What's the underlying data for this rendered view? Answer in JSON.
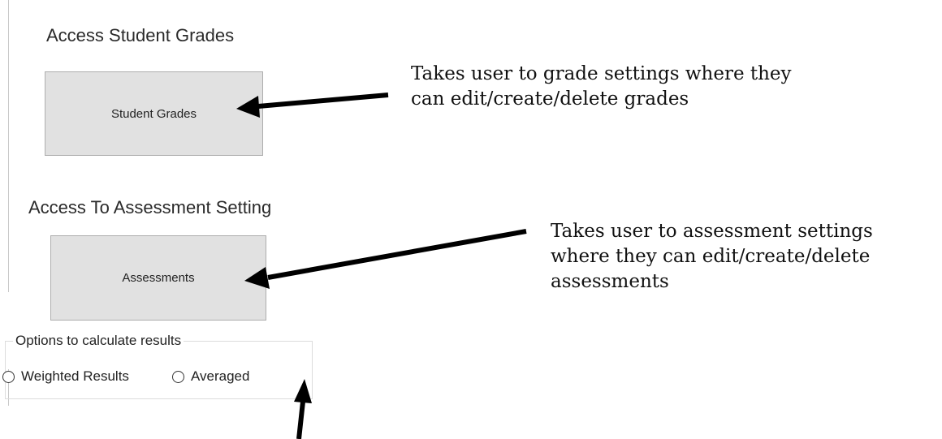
{
  "grades_section": {
    "label": "Access Student Grades",
    "button_label": "Student Grades",
    "annotation_line1": "Takes user to grade settings where they",
    "annotation_line2": "can edit/create/delete grades"
  },
  "assessment_section": {
    "label": "Access To Assessment Setting",
    "button_label": "Assessments",
    "annotation_line1": "Takes user to assessment settings",
    "annotation_line2": "where they can edit/create/delete",
    "annotation_line3": "assessments"
  },
  "results_options": {
    "legend": "Options to calculate results",
    "options": [
      {
        "label": "Weighted Results",
        "selected": false
      },
      {
        "label": "Averaged",
        "selected": false
      }
    ]
  },
  "colors": {
    "button_bg": "#e1e1e1",
    "button_border": "#adadad",
    "arrow": "#000000"
  }
}
